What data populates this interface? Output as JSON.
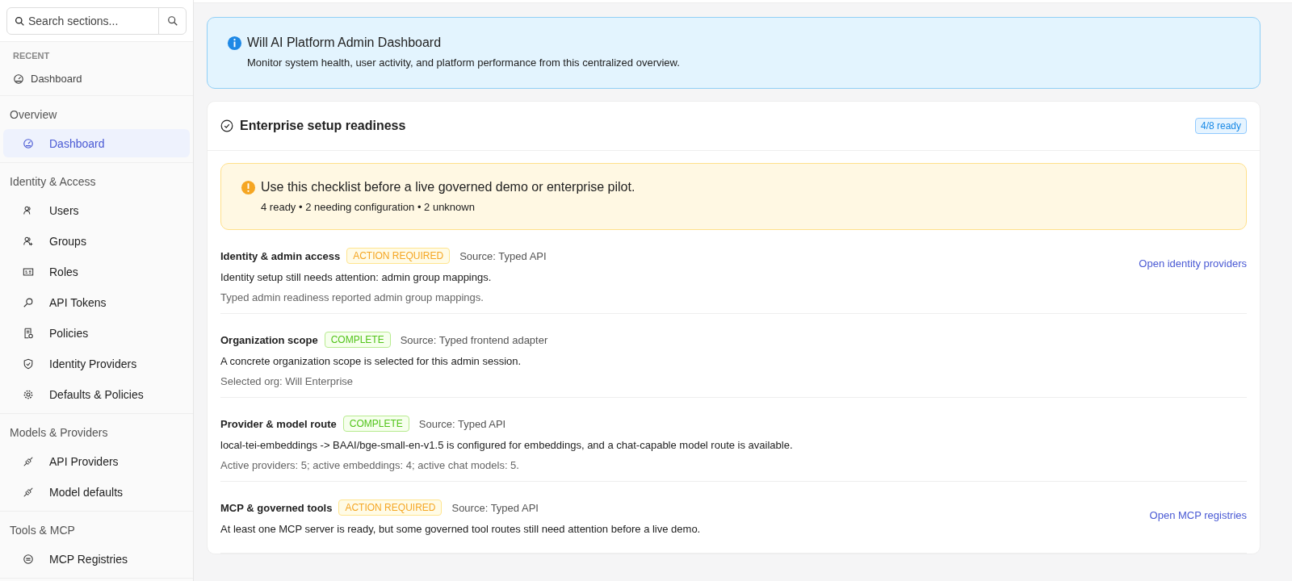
{
  "sidebar": {
    "search": {
      "placeholder": "Search sections..."
    },
    "recent": {
      "heading": "RECENT",
      "items": [
        {
          "label": "Dashboard"
        }
      ]
    },
    "sections": [
      {
        "heading": "Overview",
        "items": [
          {
            "label": "Dashboard",
            "selected": true
          }
        ]
      },
      {
        "heading": "Identity & Access",
        "items": [
          {
            "label": "Users",
            "selected": false
          },
          {
            "label": "Groups",
            "selected": false
          },
          {
            "label": "Roles",
            "selected": false
          },
          {
            "label": "API Tokens",
            "selected": false
          },
          {
            "label": "Policies",
            "selected": false
          },
          {
            "label": "Identity Providers",
            "selected": false
          },
          {
            "label": "Defaults & Policies",
            "selected": false
          }
        ]
      },
      {
        "heading": "Models & Providers",
        "items": [
          {
            "label": "API Providers",
            "selected": false
          },
          {
            "label": "Model defaults",
            "selected": false
          }
        ]
      },
      {
        "heading": "Tools & MCP",
        "items": [
          {
            "label": "MCP Registries",
            "selected": false
          }
        ]
      }
    ]
  },
  "info_banner": {
    "title": "Will AI Platform Admin Dashboard",
    "text": "Monitor system health, user activity, and platform performance from this centralized overview."
  },
  "readiness": {
    "title": "Enterprise setup readiness",
    "badge": "4/8 ready",
    "notice": {
      "title": "Use this checklist before a live governed demo or enterprise pilot.",
      "text": "4 ready • 2 needing configuration • 2 unknown"
    },
    "items": [
      {
        "title": "Identity & admin access",
        "kind": "action",
        "status_label": "ACTION REQUIRED",
        "source": "Source: Typed API",
        "description": "Identity setup still needs attention: admin group mappings.",
        "detail": "Typed admin readiness reported admin group mappings.",
        "link": "Open identity providers"
      },
      {
        "title": "Organization scope",
        "kind": "complete",
        "status_label": "COMPLETE",
        "source": "Source: Typed frontend adapter",
        "description": "A concrete organization scope is selected for this admin session.",
        "detail": "Selected org: Will Enterprise"
      },
      {
        "title": "Provider & model route",
        "kind": "complete",
        "status_label": "COMPLETE",
        "source": "Source: Typed API",
        "description": "local-tei-embeddings -> BAAI/bge-small-en-v1.5 is configured for embeddings, and a chat-capable model route is available.",
        "detail": "Active providers: 5; active embeddings: 4; active chat models: 5."
      },
      {
        "title": "MCP & governed tools",
        "kind": "action",
        "status_label": "ACTION REQUIRED",
        "source": "Source: Typed API",
        "description": "At least one MCP server is ready, but some governed tool routes still need attention before a live demo.",
        "link": "Open MCP registries"
      }
    ]
  }
}
